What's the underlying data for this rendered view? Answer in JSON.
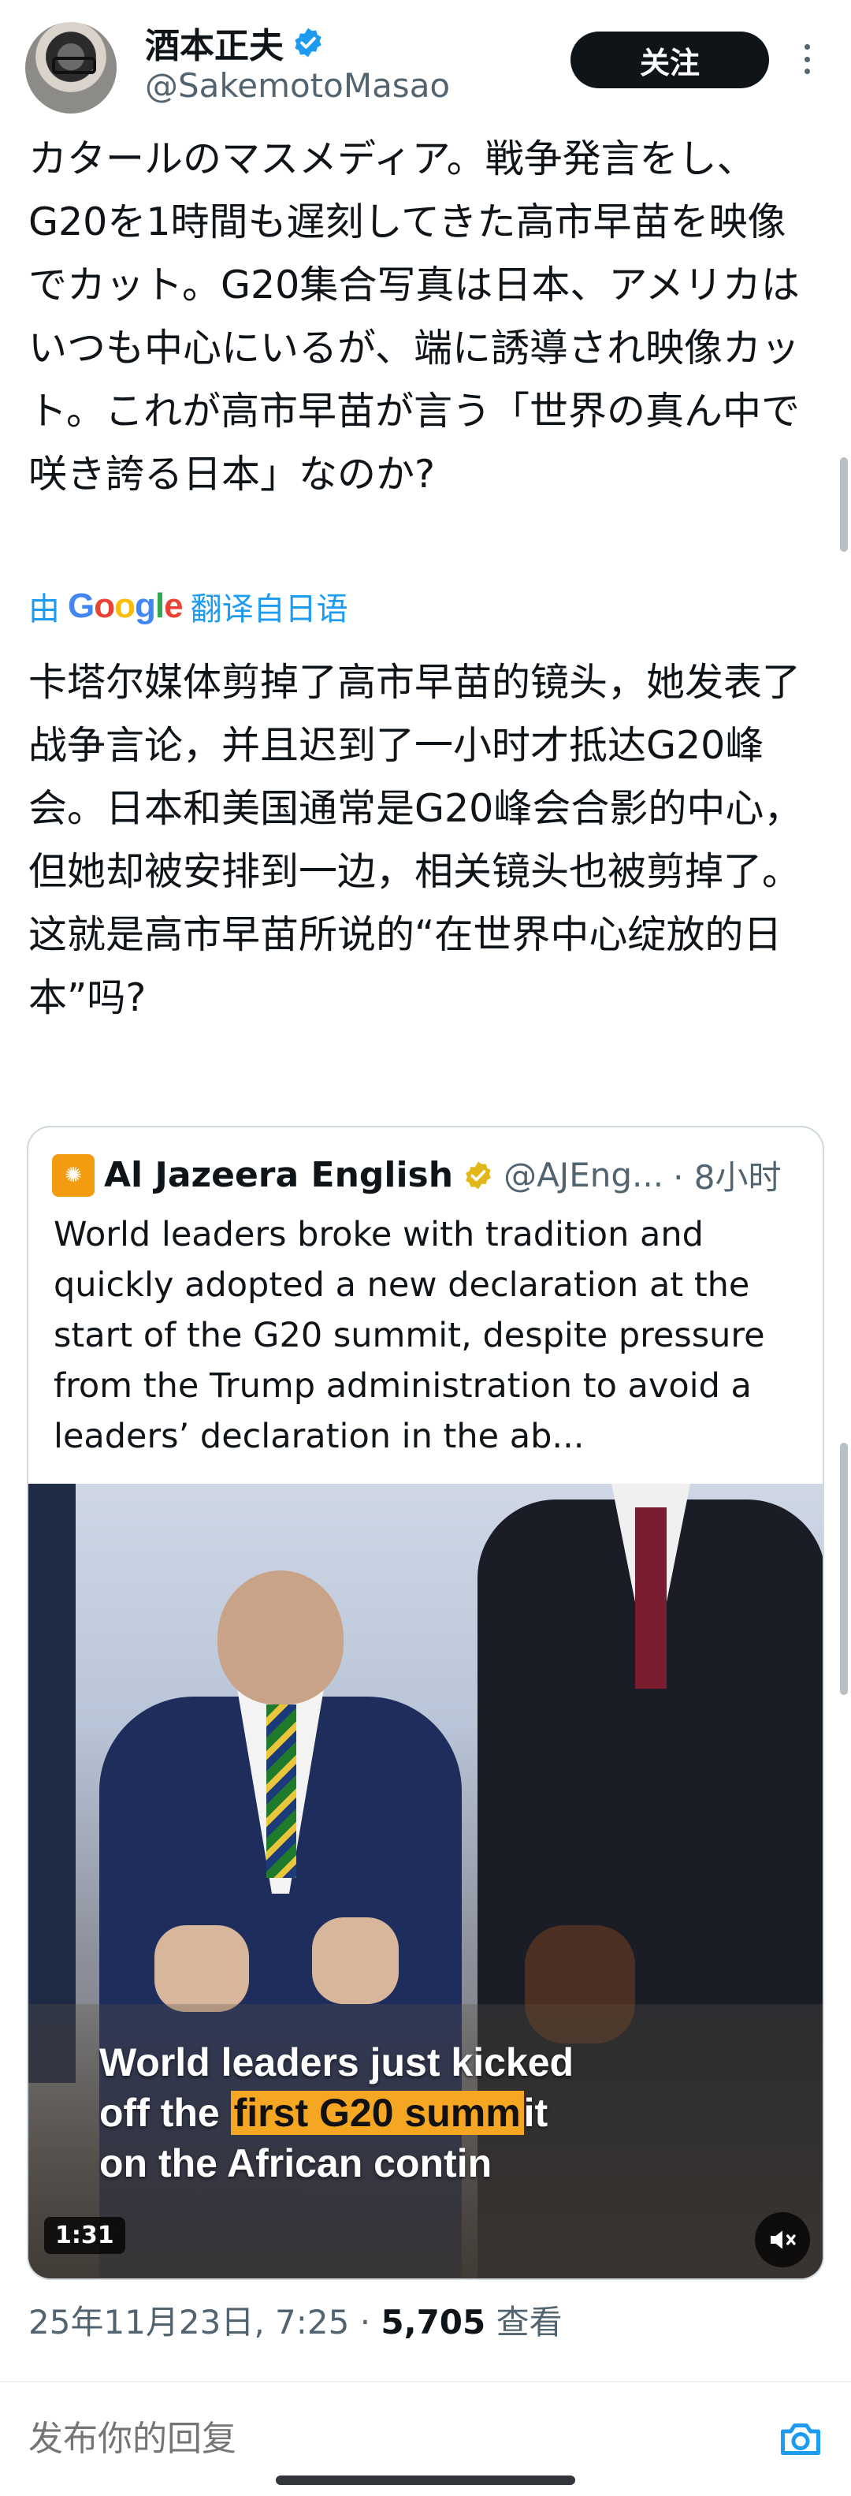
{
  "author": {
    "display_name": "酒本正夫",
    "handle": "@SakemotoMasao",
    "verified_icon": "verified-badge-icon"
  },
  "actions": {
    "follow_label": "关注",
    "more_icon": "more-dots-icon"
  },
  "tweet": {
    "text": "カタールのマスメディア。戦争発言をし、G20を1時間も遅刻してきた高市早苗を映像でカット。G20集合写真は日本、アメリカはいつも中心にいるが、端に誘導され映像カット。これが高市早苗が言う「世界の真ん中で咲き誇る日本」なのか?",
    "translate_by": "由",
    "translate_engine": "Google",
    "translate_from": "翻译自日语",
    "translated_text": "卡塔尔媒体剪掉了高市早苗的镜头，她发表了战争言论，并且迟到了一小时才抵达G20峰会。日本和美国通常是G20峰会合影的中心，但她却被安排到一边，相关镜头也被剪掉了。这就是高市早苗所说的“在世界中心绽放的日本”吗?"
  },
  "quote": {
    "name": "Al Jazeera English",
    "handle": "@AJEng...",
    "time": "· 8小时",
    "text": "World leaders broke with tradition and quickly adopted a new declaration at the start of the G20 summit, despite pressure from the Trump administration to avoid a leaders’ declaration in the ab...",
    "video": {
      "caption_line1": "World leaders just kicked",
      "caption_prefix": "off the ",
      "caption_highlight": "first G20 summ",
      "caption_suffix": "it",
      "caption_line3": "on the African contin",
      "duration": "1:31",
      "mute_icon": "speaker-muted-icon"
    }
  },
  "meta": {
    "date": "25年11月23日, 7:25 · ",
    "views_count": "5,705",
    "views_label": " 查看"
  },
  "reply": {
    "placeholder": "发布你的回复",
    "camera_icon": "camera-icon"
  },
  "colors": {
    "accent": "#1d9bf0",
    "text": "#0f1419",
    "secondary": "#536471",
    "highlight": "#f5a623"
  }
}
